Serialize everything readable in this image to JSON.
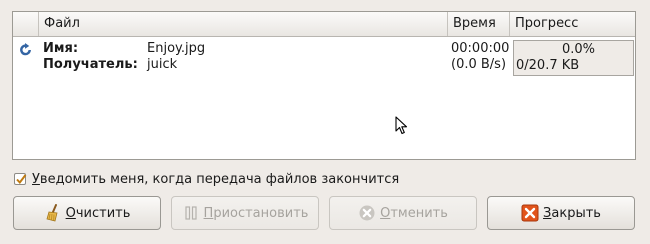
{
  "table": {
    "headers": {
      "file": "Файл",
      "time": "Время",
      "progress": "Прогресс"
    },
    "rows": [
      {
        "status_icon": "refresh-icon",
        "name_label": "Имя:",
        "name_value": "Enjoy.jpg",
        "recipient_label": "Получатель:",
        "recipient_value": "juick",
        "time_elapsed": "00:00:00",
        "speed": "(0.0 B/s)",
        "progress_percent": "0.0%",
        "progress_fraction": 0.0,
        "size": "0/20.7 KB"
      }
    ]
  },
  "notify": {
    "checked": true,
    "label_underlined": "У",
    "label_rest": "ведомить меня, когда передача файлов закончится"
  },
  "buttons": {
    "clear": {
      "mnemonic": "О",
      "rest": "чистить",
      "icon": "broom-icon",
      "enabled": true
    },
    "pause": {
      "mnemonic": "П",
      "rest": "риостановить",
      "icon": "pause-icon",
      "enabled": false
    },
    "cancel": {
      "mnemonic": "О",
      "rest": "тменить",
      "icon": "cancel-icon",
      "enabled": false
    },
    "close": {
      "mnemonic": "З",
      "rest": "акрыть",
      "icon": "close-icon",
      "enabled": true
    }
  },
  "colors": {
    "window_bg": "#efebe7",
    "close_icon_red": "#e2541b",
    "refresh_icon_blue": "#3465a4"
  }
}
